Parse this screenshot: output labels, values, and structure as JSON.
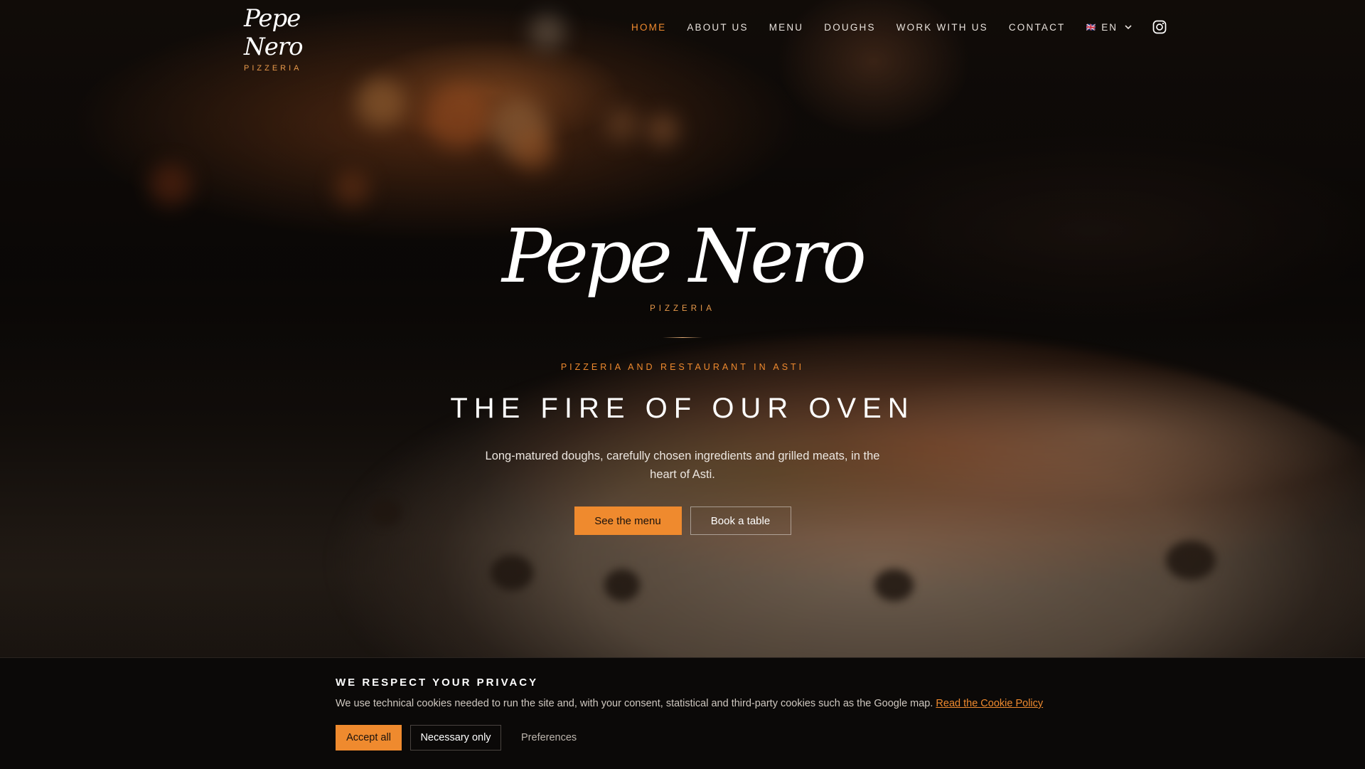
{
  "brand": {
    "name": "Pepe Nero",
    "subtitle": "PIZZERIA"
  },
  "nav": {
    "items": [
      {
        "label": "HOME",
        "active": true
      },
      {
        "label": "ABOUT US",
        "active": false
      },
      {
        "label": "MENU",
        "active": false
      },
      {
        "label": "DOUGHS",
        "active": false
      },
      {
        "label": "WORK WITH US",
        "active": false
      },
      {
        "label": "CONTACT",
        "active": false
      }
    ],
    "language": {
      "flag": "🇬🇧",
      "code": "EN"
    },
    "social_icon": "instagram-icon"
  },
  "hero": {
    "logo": "Pepe Nero",
    "logo_subtitle": "PIZZERIA",
    "eyebrow": "PIZZERIA AND RESTAURANT IN ASTI",
    "headline": "THE FIRE OF OUR OVEN",
    "tagline": "Long-matured doughs, carefully chosen ingredients and grilled meats, in the heart of Asti.",
    "primary_button": "See the menu",
    "secondary_button": "Book a table"
  },
  "cookie_banner": {
    "title": "WE RESPECT YOUR PRIVACY",
    "text": "We use technical cookies needed to run the site and, with your consent, statistical and third-party cookies such as the Google map. ",
    "link": "Read the Cookie Policy",
    "accept_all": "Accept all",
    "necessary_only": "Necessary only",
    "preferences": "Preferences"
  },
  "colors": {
    "accent": "#ef8a2e",
    "background": "#0e0a08",
    "banner": "#0b0908"
  }
}
